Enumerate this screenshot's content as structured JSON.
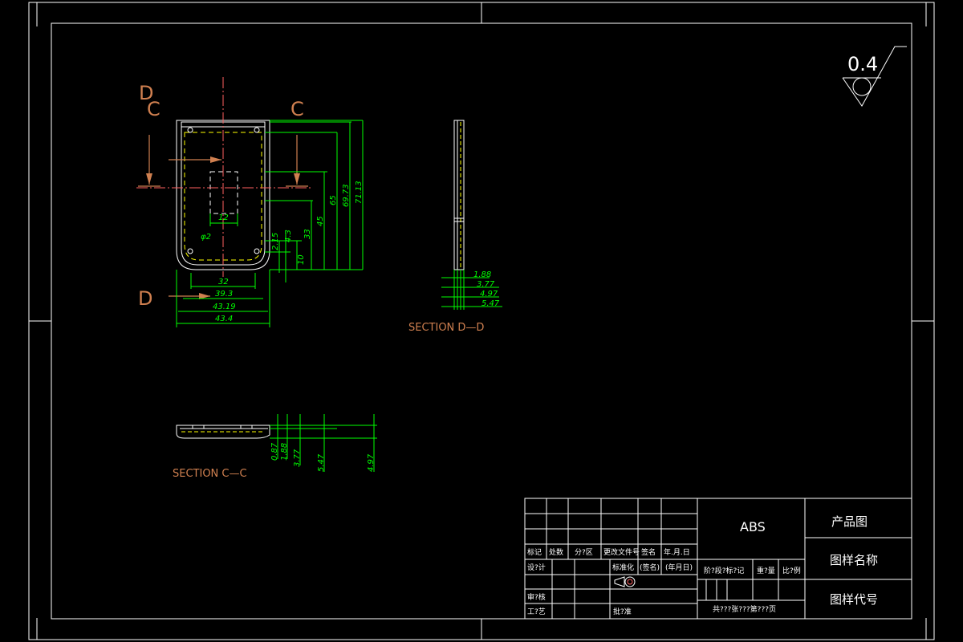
{
  "roughness": "0.4",
  "section_markers": {
    "d_top": "D",
    "c_top_left": "C",
    "c_top_right": "C",
    "d_bottom": "D"
  },
  "front_view": {
    "horizontal_dims": [
      "12",
      "φ2",
      "32",
      "39.3",
      "43.19",
      "43.4"
    ],
    "vertical_dims": [
      "2.15",
      "4.3",
      "10",
      "33",
      "45",
      "65",
      "69.73",
      "71.13"
    ]
  },
  "section_dd": {
    "title": "SECTION D—D",
    "dims": [
      "1.88",
      "3.77",
      "4.97",
      "5.47"
    ]
  },
  "section_cc": {
    "title": "SECTION C—C",
    "dims": [
      "0.87",
      "1.88",
      "3.77",
      "5.47",
      "4.97"
    ]
  },
  "title_block": {
    "material": "ABS",
    "product_label": "产品图",
    "drawing_name_label": "图样名称",
    "drawing_code_label": "图样代号",
    "row_mark": "标记",
    "row_count": "处数",
    "row_zone": "分?区",
    "row_change_doc": "更改文件号",
    "row_sign": "签名",
    "row_date": "年.月.日",
    "design": "设?计",
    "standardize": "标准化",
    "sign2": "(签名)",
    "date2": "(年月日)",
    "stage_mark": "阶?段?标?记",
    "weight": "重?量",
    "scale": "比?例",
    "review": "审?核",
    "process": "工?艺",
    "approve": "批?准",
    "sheets": "共???张???第???页"
  }
}
